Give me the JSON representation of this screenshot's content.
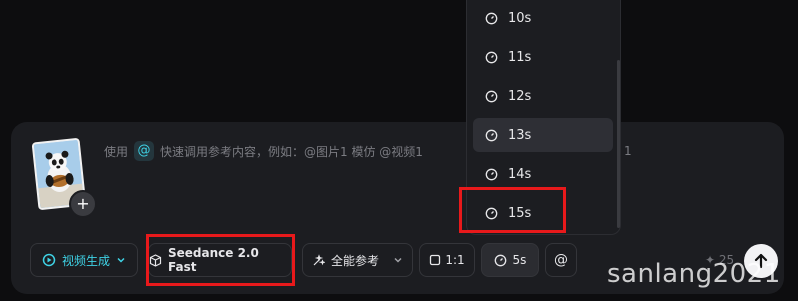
{
  "prompt": {
    "prefix": "使用",
    "at_symbol": "@",
    "text": "快速调用参考内容，例如：@图片1 模仿 @视频1",
    "tail": "1"
  },
  "reference": {
    "add_label": "+"
  },
  "toolbar": {
    "mode_label": "视频生成",
    "model_label": "Seedance 2.0 Fast",
    "reference_label": "全能参考",
    "ratio_label": "1:1",
    "duration_label": "5s",
    "at_label": "@"
  },
  "credits": {
    "value": "✦ 25"
  },
  "dropdown": {
    "options": [
      "10s",
      "11s",
      "12s",
      "13s",
      "14s",
      "15s"
    ],
    "hovered": "13s",
    "highlighted": "15s"
  },
  "watermark": "sanlang2021",
  "colors": {
    "accent": "#3fd3e6",
    "highlight_box": "#e8191b",
    "panel": "#1c1d21"
  }
}
